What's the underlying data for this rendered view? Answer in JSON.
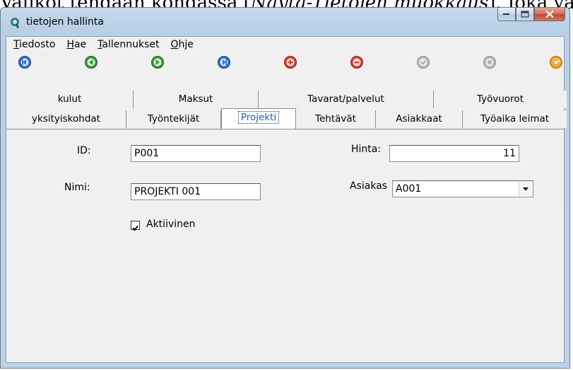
{
  "background_text": {
    "prefix": "Valikot tehdään kohdassa [",
    "italic": "Näytä-Tietojen muokkaus",
    "suffix": "]. Joka va"
  },
  "window": {
    "title": "tietojen hallinta",
    "icon": "app-icon"
  },
  "menu": [
    {
      "label": "Tiedosto",
      "accel": "T",
      "rest": "iedosto"
    },
    {
      "label": "Hae",
      "accel": "H",
      "rest": "ae"
    },
    {
      "label": "Tallennukset",
      "accel": "T",
      "rest": "allennukset"
    },
    {
      "label": "Ohje",
      "accel": "O",
      "rest": "hje"
    }
  ],
  "toolbar_icons": [
    {
      "name": "first-record-icon",
      "color": "#2b6cc8"
    },
    {
      "name": "previous-record-icon",
      "color": "#2f9a2f"
    },
    {
      "name": "next-record-icon",
      "color": "#2f9a2f"
    },
    {
      "name": "last-record-icon",
      "color": "#2b6cc8"
    },
    {
      "name": "add-record-icon",
      "color": "#d83a2a"
    },
    {
      "name": "delete-record-icon",
      "color": "#d83a2a"
    },
    {
      "name": "save-record-icon",
      "color": "#a8a8a8"
    },
    {
      "name": "cancel-record-icon",
      "color": "#a8a8a8"
    },
    {
      "name": "refresh-icon",
      "color": "#e89a1c"
    }
  ],
  "tabs_back": [
    "kulut",
    "Maksut",
    "Tavarat/palvelut",
    "Työvuorot"
  ],
  "tabs_front": [
    "yksityiskohdat",
    "Työntekijät",
    "Projekti",
    "Tehtävät",
    "Asiakkaat",
    "Työaika leimat"
  ],
  "active_tab": "Projekti",
  "form": {
    "id_label": "ID:",
    "id_value": "P001",
    "name_label": "Nimi:",
    "name_value": "PROJEKTI 001",
    "active_label": "Aktiivinen",
    "active_checked": true,
    "price_label": "Hinta:",
    "price_value": "11",
    "customer_label": "Asiakas",
    "customer_value": "A001"
  }
}
